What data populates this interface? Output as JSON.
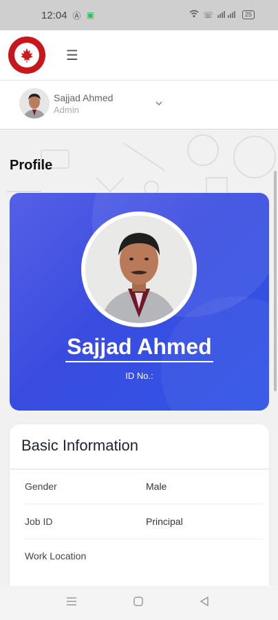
{
  "status_bar": {
    "time": "12:04",
    "icons": [
      "a-circle-icon",
      "whatsapp-icon",
      "wifi-icon",
      "volte-icon",
      "signal-icon"
    ],
    "battery": "25"
  },
  "app": {
    "menu_icon": "hamburger-icon",
    "logo_icon": "maple-leaf-icon"
  },
  "user": {
    "name": "Sajjad Ahmed",
    "role": "Admin"
  },
  "page": {
    "title": "Profile"
  },
  "profile": {
    "name": "Sajjad Ahmed",
    "id_label": "ID No.:"
  },
  "basic_info": {
    "title": "Basic Information",
    "rows": [
      {
        "label": "Gender",
        "value": "Male"
      },
      {
        "label": "Job ID",
        "value": "Principal"
      },
      {
        "label": "Work Location",
        "value": ""
      }
    ]
  },
  "colors": {
    "card_gradient_start": "#5560e6",
    "card_gradient_end": "#2f55e6",
    "logo_red": "#c8161d"
  }
}
